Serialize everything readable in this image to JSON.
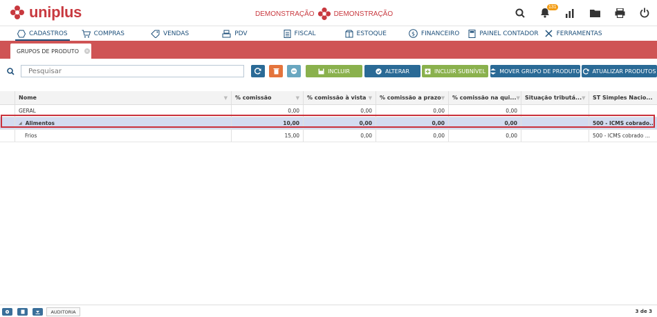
{
  "app": {
    "logo_text": "uniplus",
    "demo_left": "DEMONSTRAÇÃO",
    "demo_right": "DEMONSTRAÇÃO",
    "notifications_count": "131"
  },
  "top_icons": [
    "search-icon",
    "bell-icon",
    "chart-icon",
    "folder-icon",
    "printer-icon",
    "power-icon"
  ],
  "nav": [
    {
      "label": "CADASTROS",
      "icon": "hexagon-icon",
      "active": true
    },
    {
      "label": "COMPRAS",
      "icon": "cart-icon"
    },
    {
      "label": "VENDAS",
      "icon": "tag-icon"
    },
    {
      "label": "PDV",
      "icon": "register-icon"
    },
    {
      "label": "FISCAL",
      "icon": "document-icon"
    },
    {
      "label": "ESTOQUE",
      "icon": "box-icon"
    },
    {
      "label": "FINANCEIRO",
      "icon": "dollar-icon"
    },
    {
      "label": "PAINEL CONTADOR",
      "icon": "calculator-icon"
    },
    {
      "label": "FERRAMENTAS",
      "icon": "tools-icon"
    }
  ],
  "tab": {
    "label": "GRUPOS DE PRODUTO"
  },
  "search": {
    "placeholder": "Pesquisar"
  },
  "toolbar": {
    "incluir": "INCLUIR",
    "alterar": "ALTERAR",
    "incluir_subnivel": "INCLUIR SUBNÍVEL",
    "mover_grupo": "MOVER GRUPO DE PRODUTO",
    "atualizar": "ATUALIZAR PRODUTOS"
  },
  "colors": {
    "brand": "#c8393f",
    "tabbar": "#cf5455",
    "blue": "#2a6a96",
    "green": "#8ab14d",
    "orange": "#e4743c",
    "teal": "#6aa7c0",
    "selection": "#d3dbf0"
  },
  "table": {
    "headers": [
      "Nome",
      "% comissão",
      "% comissão à vista",
      "% comissão a prazo",
      "% comissão na qui...",
      "Situação tributá...",
      "ST Simples Nacio..."
    ],
    "rows": [
      {
        "nome": "GERAL",
        "comissao": "0,00",
        "avista": "0,00",
        "aprazo": "0,00",
        "quitacao": "0,00",
        "situacao": "",
        "st": ""
      },
      {
        "nome": "Alimentos",
        "comissao": "10,00",
        "avista": "0,00",
        "aprazo": "0,00",
        "quitacao": "0,00",
        "situacao": "",
        "st": "500 - ICMS cobrado..."
      },
      {
        "nome": "Frios",
        "comissao": "15,00",
        "avista": "0,00",
        "aprazo": "0,00",
        "quitacao": "0,00",
        "situacao": "",
        "st": "500 - ICMS cobrado ..."
      }
    ]
  },
  "footer": {
    "auditoria": "AUDITORIA",
    "count": "3 de 3"
  }
}
